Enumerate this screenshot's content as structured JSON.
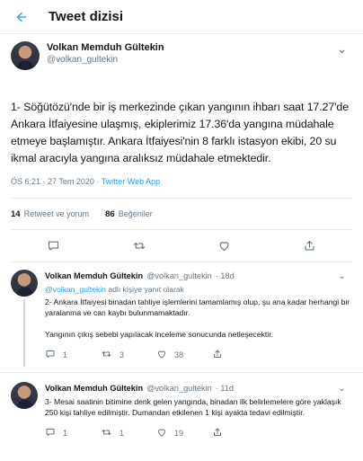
{
  "header": {
    "title": "Tweet dizisi"
  },
  "main_tweet": {
    "name": "Volkan Memduh Gültekin",
    "handle": "@volkan_gultekin",
    "text": "1- Söğütözü'nde bir iş merkezinde çıkan yangının ihbarı saat 17.27'de Ankara İtfaiyesine ulaşmış, ekiplerimiz 17.36'da yangına müdahale etmeye başlamıştır. Ankara İtfaiyesi'nin 8 farklı istasyon ekibi, 20 su ikmal aracıyla yangına aralıksız müdahale etmektedir.",
    "time": "ÖS 6:21 · 27 Tem 2020 · ",
    "source": "Twitter Web App",
    "retweets_count": "14",
    "retweets_label": "Retweet ve yorum",
    "likes_count": "86",
    "likes_label": "Beğeniler"
  },
  "replies": [
    {
      "name": "Volkan Memduh Gültekin",
      "handle": "@volkan_gultekin",
      "age": "· 18d",
      "mention": "@volkan_gultekin",
      "replying_suffix": " adlı kişiye yanıt olarak",
      "text": "2- Ankara İtfaiyesi binadan tahliye işlemlerini tamamlamış olup, şu ana kadar herhangi bir yaralanma ve can kaybı bulunmamaktadır.\n\nYangının çıkış sebebi yapılacak inceleme sonucunda netleşecektir.",
      "reply_count": "1",
      "retweet_count": "3",
      "like_count": "38"
    },
    {
      "name": "Volkan Memduh Gültekin",
      "handle": "@volkan_gultekin",
      "age": "· 11d",
      "text": "3- Mesai saatinin bitimine denk gelen yangında, binadan ilk belirlemelere göre yaklaşık 250 kişi tahliye edilmiştir. Dumandan etkilenen 1 kişi ayakta tedavi edilmiştir.",
      "reply_count": "1",
      "retweet_count": "1",
      "like_count": "19"
    }
  ],
  "icons": {
    "back": "arrow-left",
    "more": "ellipsis",
    "reply": "speech-bubble",
    "retweet": "retweet-arrows",
    "like": "heart",
    "share": "share-upload"
  },
  "colors": {
    "accent": "#1da1f2",
    "muted": "#657786",
    "border": "#e6ecf0"
  }
}
